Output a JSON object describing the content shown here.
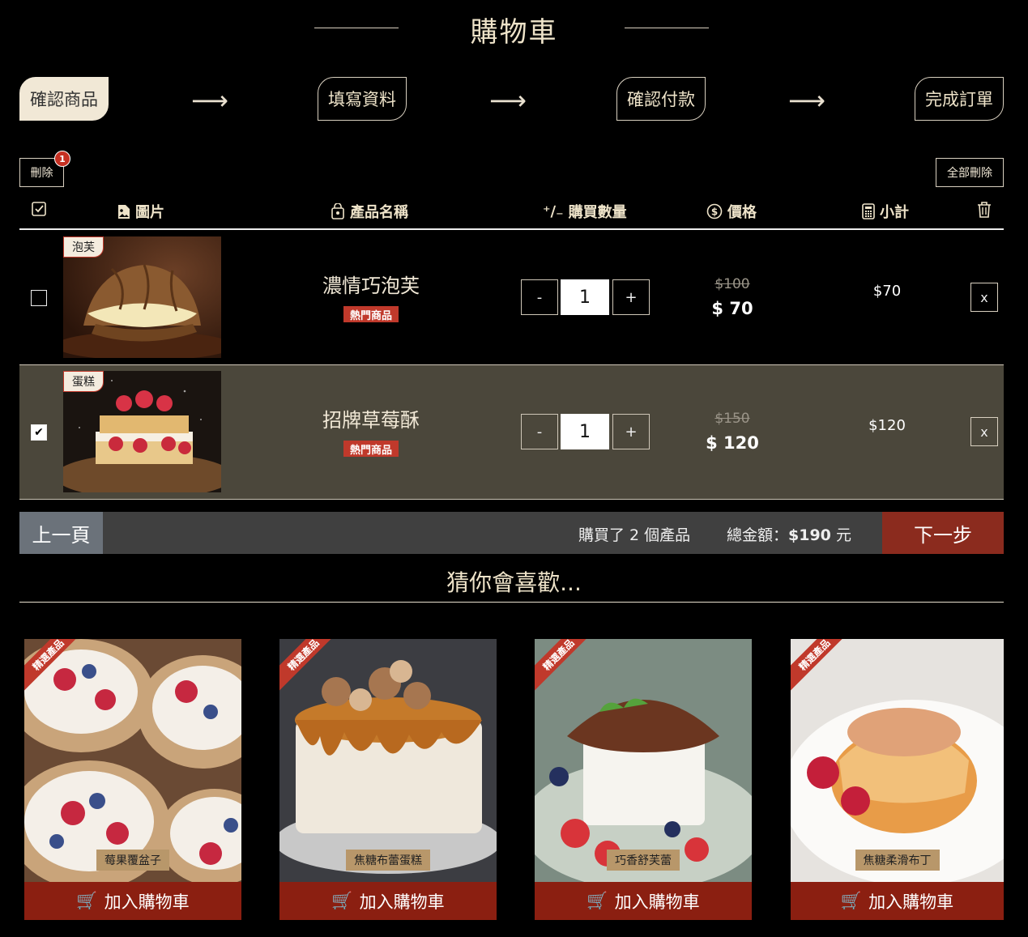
{
  "header": {
    "title": "購物車"
  },
  "steps": [
    "確認商品",
    "填寫資料",
    "確認付款",
    "完成訂單"
  ],
  "toolbar": {
    "delete_label": "刪除",
    "delete_count": "1",
    "delete_all_label": "全部刪除"
  },
  "table": {
    "headers": [
      "圖片",
      "產品名稱",
      "購買數量",
      "價格",
      "小計"
    ]
  },
  "items": [
    {
      "category": "泡芙",
      "name": "濃情巧泡芙",
      "tag": "熱門商品",
      "qty": "1",
      "old_price": "$100",
      "price": "$ 70",
      "subtotal": "$70",
      "checked": false
    },
    {
      "category": "蛋糕",
      "name": "招牌草莓酥",
      "tag": "熱門商品",
      "qty": "1",
      "old_price": "$150",
      "price": "$ 120",
      "subtotal": "$120",
      "checked": true
    }
  ],
  "qty_controls": {
    "minus": "-",
    "plus": "+",
    "remove": "x"
  },
  "footer": {
    "prev_label": "上一頁",
    "summary": "購買了 2 個產品",
    "total_label": "總金額：",
    "total_value": "$190",
    "total_unit": " 元",
    "next_label": "下一步"
  },
  "recommend": {
    "title": "猜你會喜歡...",
    "ribbon": "精選產品",
    "add_label": "加入購物車",
    "cards": [
      "莓果覆盆子",
      "焦糖布蕾蛋糕",
      "巧香舒芙蕾",
      "焦糖柔滑布丁"
    ]
  },
  "colors": {
    "accent": "#c0392b",
    "selected_row": "#4b473b",
    "next_button": "#8b2b1e",
    "cream": "#f1e8d6"
  }
}
